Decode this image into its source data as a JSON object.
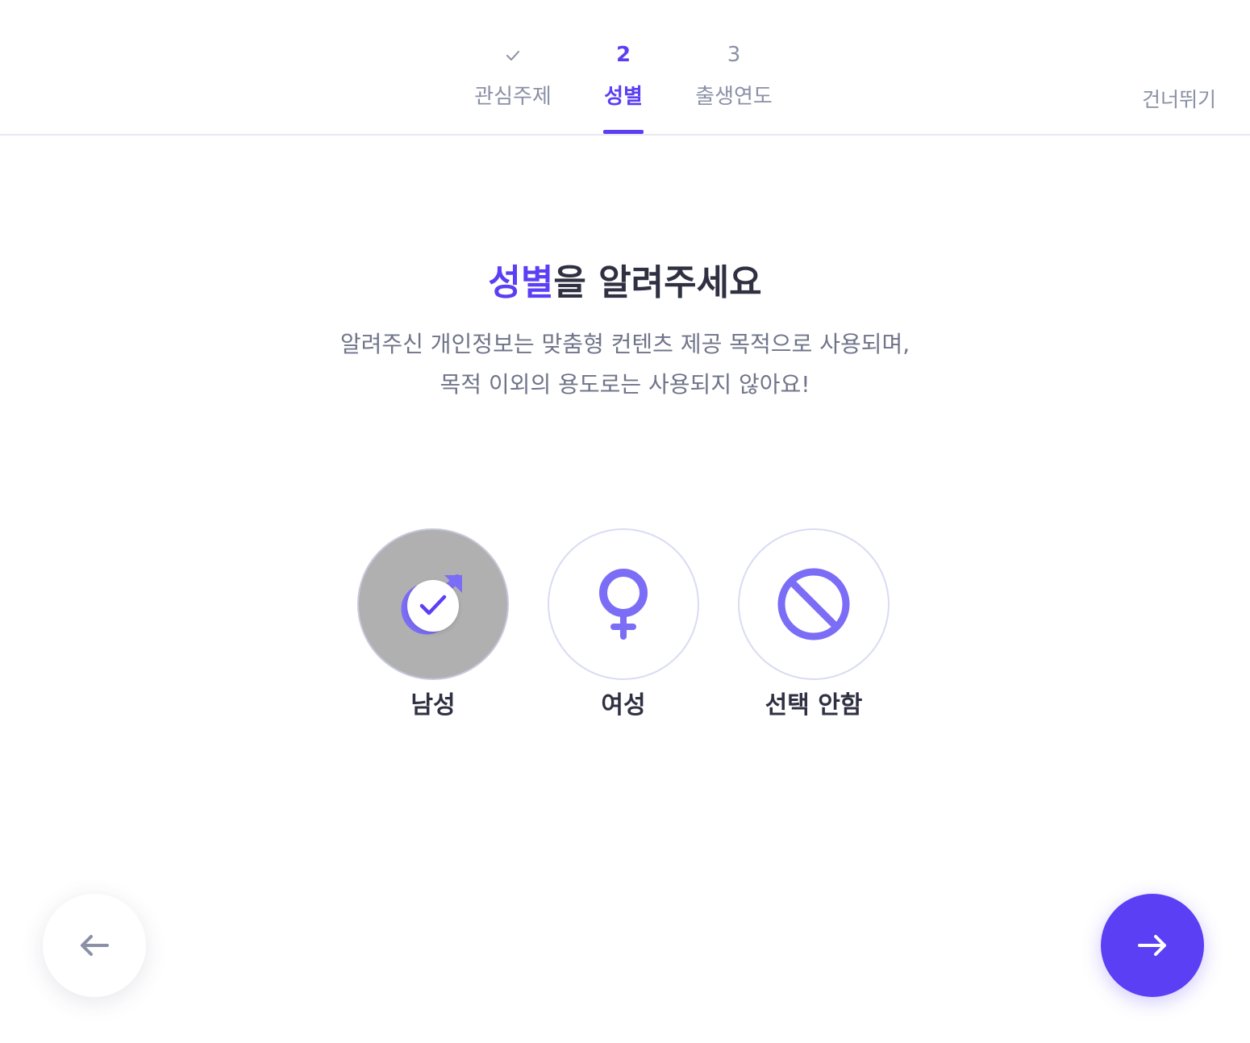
{
  "stepper": {
    "steps": [
      {
        "marker": "✓",
        "label": "관심주제",
        "state": "done"
      },
      {
        "marker": "2",
        "label": "성별",
        "state": "active"
      },
      {
        "marker": "3",
        "label": "출생연도",
        "state": "upcoming"
      }
    ],
    "skip_label": "건너뛰기"
  },
  "main": {
    "title_accent": "성별",
    "title_rest": "을 알려주세요",
    "subtitle_lines": [
      "알려주신 개인정보는 맞춤형 컨텐츠 제공 목적으로 사용되며,",
      "목적 이외의 용도로는 사용되지 않아요!"
    ],
    "options": [
      {
        "label": "남성",
        "icon": "male-symbol-icon",
        "selected": true
      },
      {
        "label": "여성",
        "icon": "female-symbol-icon",
        "selected": false
      },
      {
        "label": "선택 안함",
        "icon": "prohibited-icon",
        "selected": false
      }
    ]
  },
  "navigation": {
    "back_icon": "arrow-left-icon",
    "next_icon": "arrow-right-icon"
  },
  "colors": {
    "accent": "#5b3ff4",
    "muted_text": "#8a90a6",
    "body_text": "#2f3142",
    "selected_circle": "#b0b0b0",
    "icon_purple": "#7b6df6"
  }
}
